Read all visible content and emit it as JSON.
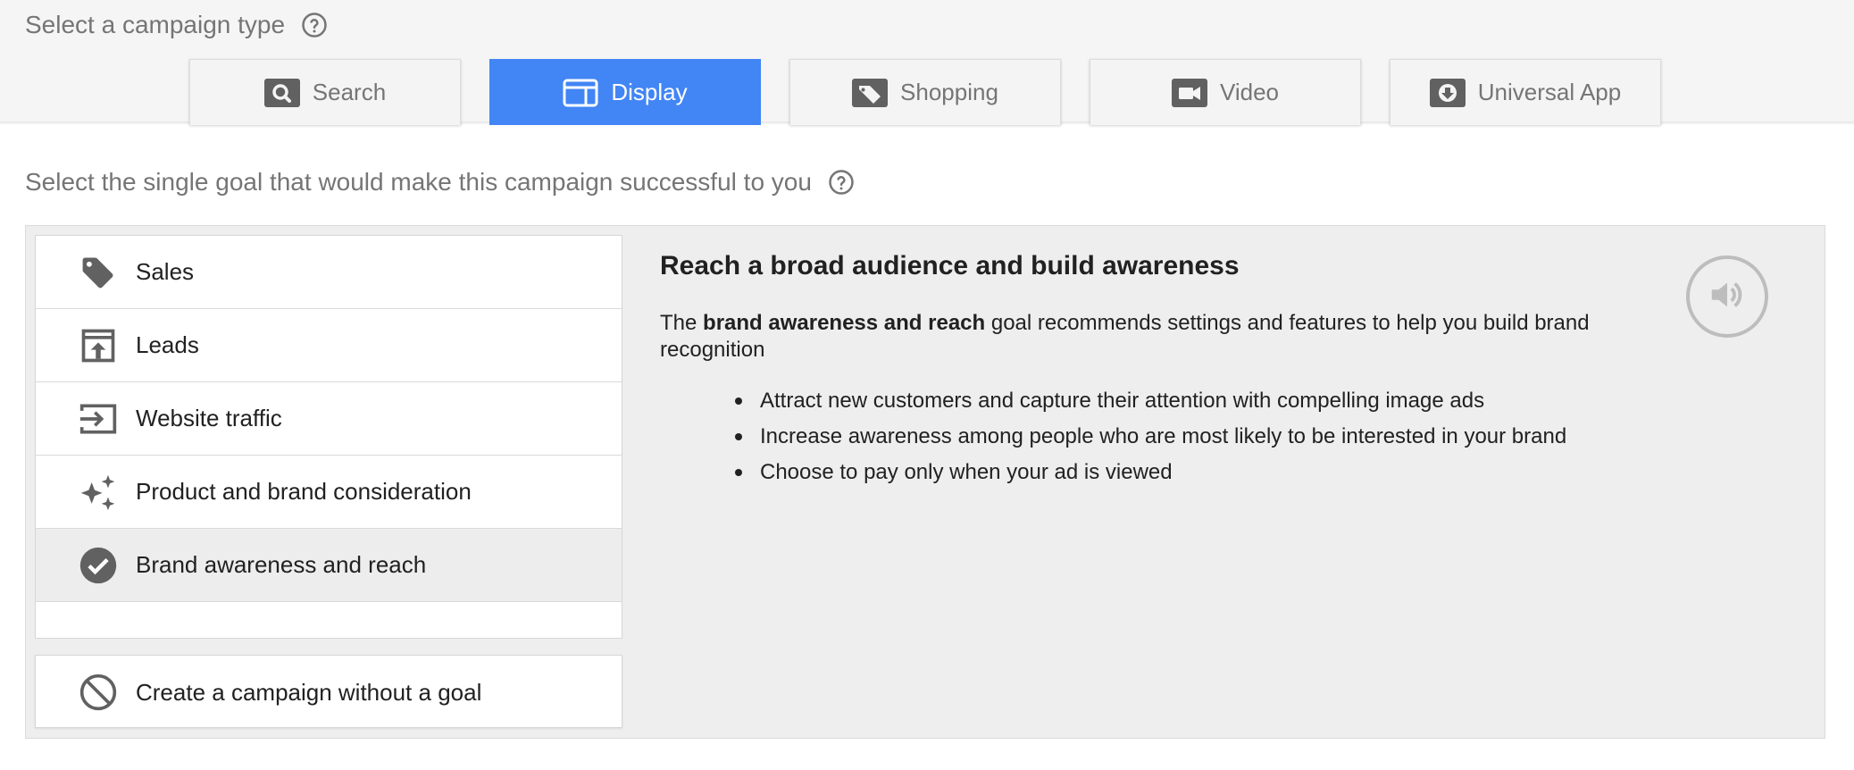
{
  "campaign_type": {
    "heading": "Select a campaign type",
    "help_icon": "help-circle-icon",
    "tabs": [
      {
        "label": "Search",
        "icon": "search-icon",
        "selected": false
      },
      {
        "label": "Display",
        "icon": "display-icon",
        "selected": true
      },
      {
        "label": "Shopping",
        "icon": "tag-icon",
        "selected": false
      },
      {
        "label": "Video",
        "icon": "video-camera-icon",
        "selected": false
      },
      {
        "label": "Universal App",
        "icon": "download-icon",
        "selected": false
      }
    ]
  },
  "goal": {
    "heading": "Select the single goal that would make this campaign successful to you",
    "help_icon": "help-circle-icon",
    "options": [
      {
        "label": "Sales",
        "icon": "tag-icon",
        "selected": false
      },
      {
        "label": "Leads",
        "icon": "upload-box-icon",
        "selected": false
      },
      {
        "label": "Website traffic",
        "icon": "enter-arrow-icon",
        "selected": false
      },
      {
        "label": "Product and brand consideration",
        "icon": "sparkle-icon",
        "selected": false
      },
      {
        "label": "Brand awareness and reach",
        "icon": "check-circle-icon",
        "selected": true
      }
    ],
    "no_goal": {
      "label": "Create a campaign without a goal",
      "icon": "block-icon"
    }
  },
  "detail": {
    "title": "Reach a broad audience and build awareness",
    "desc_prefix": "The ",
    "desc_bold": "brand awareness and reach",
    "desc_suffix": " goal recommends settings and features to help you build brand recognition",
    "benefits": [
      "Attract new customers and capture their attention with compelling image ads",
      "Increase awareness among people who are most likely to be interested in your brand",
      "Choose to pay only when your ad is viewed"
    ],
    "audio_icon": "volume-icon"
  },
  "colors": {
    "accent": "#4285f4",
    "icon_gray": "#616161",
    "panel_bg": "#eeeeee"
  }
}
